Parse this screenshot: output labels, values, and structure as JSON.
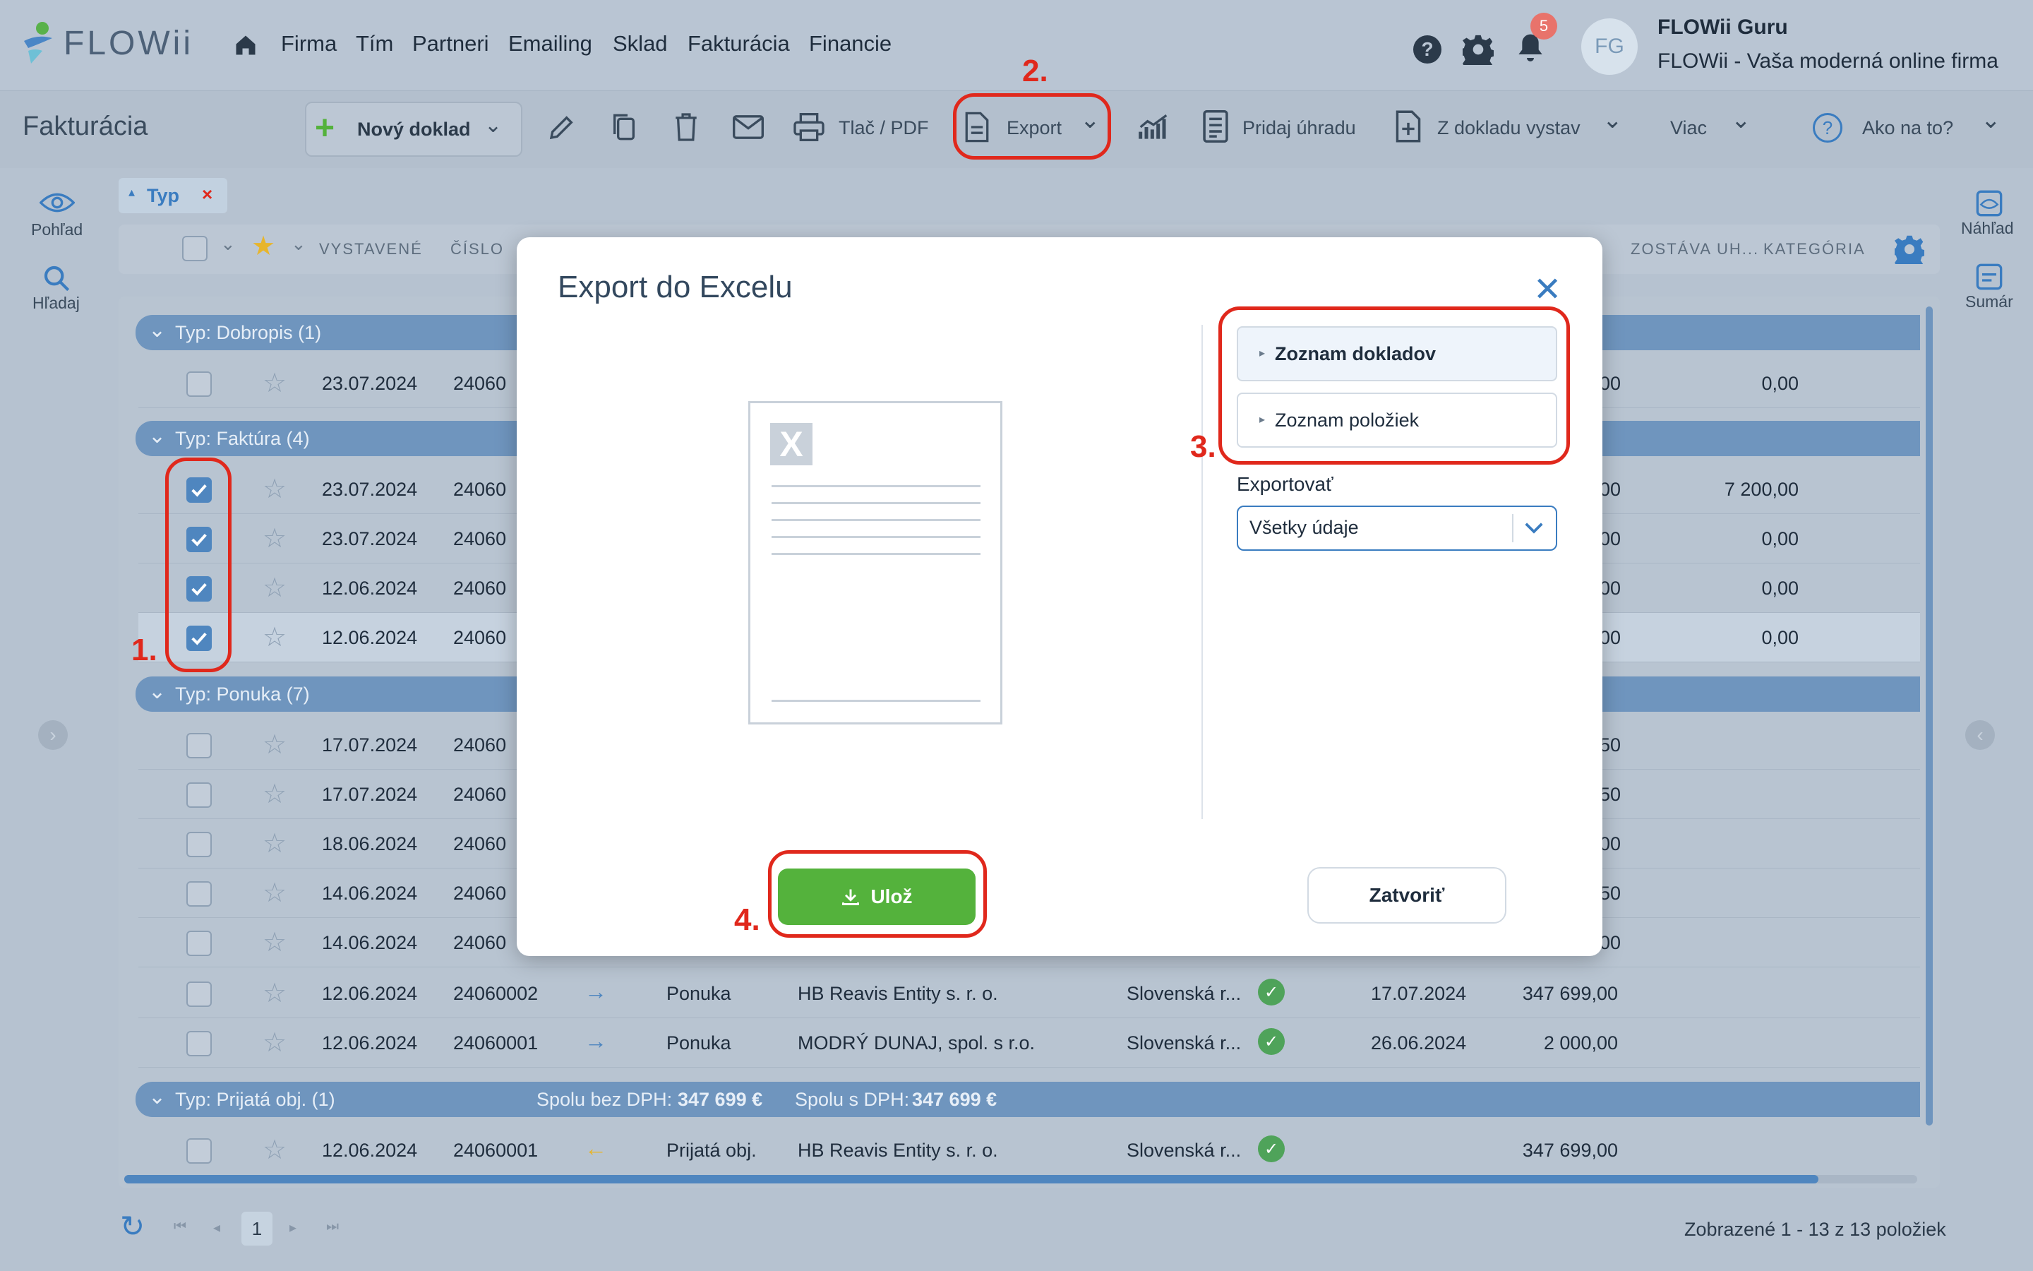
{
  "app": {
    "logo_text": "FLOWii",
    "page_title": "Fakturácia"
  },
  "nav": {
    "items": [
      "Firma",
      "Tím",
      "Partneri",
      "Emailing",
      "Sklad",
      "Fakturácia",
      "Financie"
    ]
  },
  "header": {
    "notification_count": "5",
    "avatar_initials": "FG",
    "user_name": "FLOWii Guru",
    "user_subtitle": "FLOWii - Vaša moderná online firma"
  },
  "toolbar": {
    "new_doc": "Nový doklad",
    "print_pdf": "Tlač / PDF",
    "export": "Export",
    "add_payment": "Pridaj úhradu",
    "from_doc": "Z dokladu vystav",
    "more": "Viac",
    "howto": "Ako na to?"
  },
  "annotations": {
    "n1": "1.",
    "n2": "2.",
    "n3": "3.",
    "n4": "4."
  },
  "side_left": {
    "view": "Pohľad",
    "search": "Hľadaj"
  },
  "side_right": {
    "preview": "Náhľad",
    "summary": "Sumár"
  },
  "filter_chip": {
    "label": "Typ"
  },
  "columns": {
    "issued": "VYSTAVENÉ",
    "number": "ČÍSLO",
    "remaining": "ZOSTÁVA UH...",
    "category": "KATEGÓRIA"
  },
  "groups": {
    "dobropis": "Typ: Dobropis (1)",
    "faktura": "Typ: Faktúra (4)",
    "ponuka": "Typ: Ponuka (7)",
    "prijata": "Typ: Prijatá obj. (1)",
    "prijata_net_label": "Spolu bez DPH:",
    "prijata_net": "347 699 €",
    "prijata_gross_label": "Spolu s DPH:",
    "prijata_gross": "347 699 €"
  },
  "rows": [
    {
      "date": "23.07.2024",
      "num": "24060",
      "tail": "00",
      "remaining": "0,00"
    },
    {
      "date": "23.07.2024",
      "num": "24060",
      "tail": "00",
      "remaining": "7 200,00"
    },
    {
      "date": "23.07.2024",
      "num": "24060",
      "tail": "00",
      "remaining": "0,00"
    },
    {
      "date": "12.06.2024",
      "num": "24060",
      "tail": "00",
      "remaining": "0,00"
    },
    {
      "date": "12.06.2024",
      "num": "24060",
      "tail": "00",
      "remaining": "0,00"
    },
    {
      "date": "17.07.2024",
      "num": "24060",
      "tail": "50"
    },
    {
      "date": "17.07.2024",
      "num": "24060",
      "tail": "50"
    },
    {
      "date": "18.06.2024",
      "num": "24060",
      "tail": "00"
    },
    {
      "date": "14.06.2024",
      "num": "24060",
      "tail": "50"
    },
    {
      "date": "14.06.2024",
      "num": "24060",
      "tail": "00"
    },
    {
      "date": "12.06.2024",
      "num": "24060002",
      "type": "Ponuka",
      "partner": "HB Reavis Entity s. r. o.",
      "country": "Slovenská r...",
      "due": "17.07.2024",
      "amount": "347 699,00"
    },
    {
      "date": "12.06.2024",
      "num": "24060001",
      "type": "Ponuka",
      "partner": "MODRÝ DUNAJ, spol. s r.o.",
      "country": "Slovenská r...",
      "due": "26.06.2024",
      "amount": "2 000,00"
    },
    {
      "date": "12.06.2024",
      "num": "24060001",
      "type": "Prijatá obj.",
      "partner": "HB Reavis Entity s. r. o.",
      "country": "Slovenská r...",
      "amount": "347 699,00"
    }
  ],
  "pagination": {
    "page": "1",
    "status": "Zobrazené 1 - 13 z 13 položiek"
  },
  "modal": {
    "title": "Export do Excelu",
    "option_docs": "Zoznam dokladov",
    "option_items": "Zoznam položiek",
    "export_label": "Exportovať",
    "export_value": "Všetky údaje",
    "save": "Ulož",
    "close": "Zatvoriť"
  },
  "colors": {
    "accent": "#3a7cc0",
    "group": "#6f95be",
    "save": "#54b23c",
    "annotation": "#e0281c"
  }
}
